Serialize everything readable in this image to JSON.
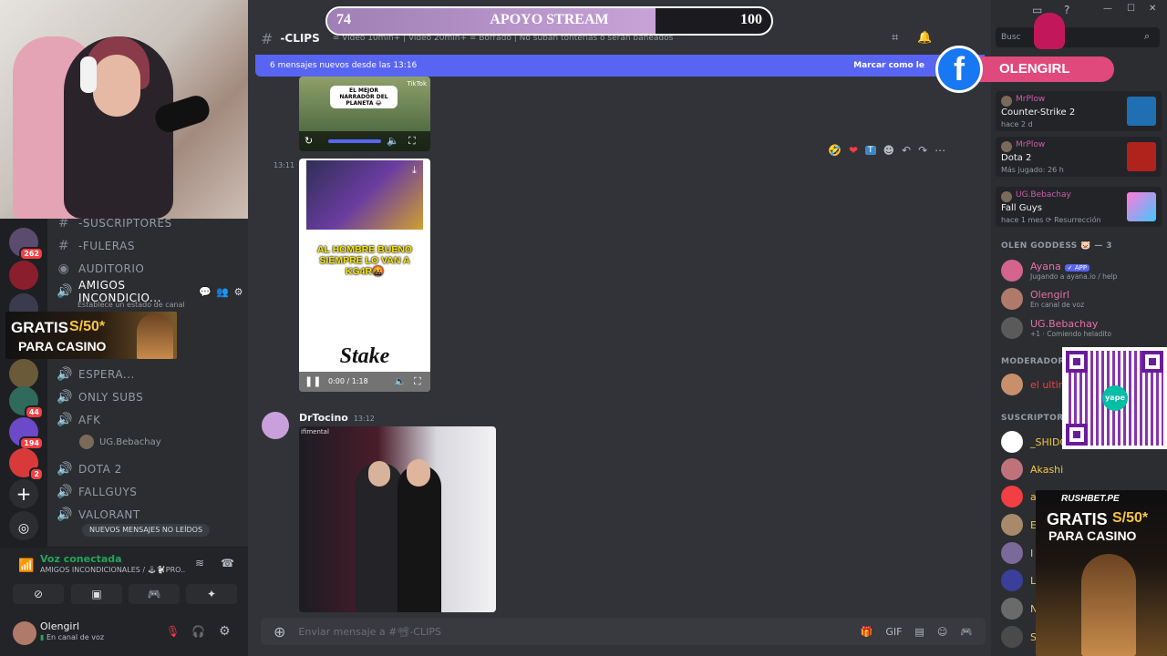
{
  "window": {
    "minimize_icon": "—",
    "maximize_icon": "☐",
    "close_icon": "✕"
  },
  "overlay": {
    "support": {
      "current": "74",
      "label": "APOYO STREAM",
      "goal": "100",
      "progress": 0.74
    },
    "facebook": {
      "glyph": "f",
      "name": "OLENGIRL"
    },
    "qr": {
      "logo": "yape"
    },
    "casino_top": {
      "line1": "GRATIS",
      "amount": "S/50*",
      "line2": "PARA CASINO"
    },
    "casino_bottom": {
      "brand": "RUSHBET.PE",
      "line1": "GRATIS",
      "amount": "S/50*",
      "line2": "PARA CASINO"
    }
  },
  "servers": [
    {
      "badge": "262"
    },
    {
      "badge": ""
    },
    {
      "badge": ""
    },
    {
      "badge": ""
    },
    {
      "badge": "44"
    },
    {
      "badge": "194"
    },
    {
      "badge": "2"
    }
  ],
  "channels": {
    "items": [
      {
        "icon": "#",
        "name": "-SUSCRIPTORES"
      },
      {
        "icon": "#",
        "name": "-FULERAS"
      },
      {
        "icon": "◉",
        "name": "AUDITORIO"
      },
      {
        "icon": "🔊",
        "name": "AMIGOS INCONDICIO...",
        "sub": "Establece un estado de canal"
      },
      {
        "icon": "🔊",
        "name": "ESPERA..."
      },
      {
        "icon": "🔊",
        "name": "ONLY SUBS"
      },
      {
        "icon": "🔊",
        "name": "AFK"
      },
      {
        "icon": "🔊",
        "name": "DOTA 2"
      },
      {
        "icon": "🔊",
        "name": "FALLGUYS"
      },
      {
        "icon": "🔊",
        "name": "VALORANT"
      }
    ],
    "afk_user": "UG.Bebachay",
    "unread_pill": "NUEVOS MENSAJES NO LEÍDOS"
  },
  "voice": {
    "status": "Voz conectada",
    "channel": "AMIGOS INCONDICIONALES / 🕹🐩PRO..."
  },
  "user": {
    "name": "Olengirl",
    "status": "En canal de voz"
  },
  "chat": {
    "channel": "-CLIPS",
    "topic": "= Video 10min+ | Video 20min+ = Borrado | No suban tonterías o serán baneados",
    "new_messages": "6 mensajes nuevos desde las 13:16",
    "mark_read": "Marcar como le",
    "clip1_caption": "EL MEJOR NARRADOR DEL PLANETA 😂",
    "clip1_brand": "TikTok",
    "msg_time_1": "13:11",
    "clip2_text": "AL HOMBRE BUENO SIEMPRE LO VAN A KG4R🤬",
    "clip2_logo": "Stake",
    "clip2_time": "0:00 / 1:18",
    "author": "DrTocino",
    "author_time": "13:12",
    "photo_text": "ifimental",
    "composer_placeholder": "Enviar mensaje a #📽-CLIPS"
  },
  "right": {
    "search_placeholder": "Busc",
    "activities": [
      {
        "who": "MrPlow",
        "game": "Counter-Strike 2",
        "meta": "hace 2 d"
      },
      {
        "who": "MrPlow",
        "game": "Dota 2",
        "meta": "Más jugado: 26 h"
      },
      {
        "who": "UG.Bebachay",
        "game": "Fall Guys",
        "meta": "hace 1 mes  ⟳ Resurrección"
      }
    ],
    "group_goddess": "OLEN GODDESS 🐷 — 3",
    "members": [
      {
        "name": "Ayana",
        "tag": "✓ APP",
        "status": "Jugando a ayana.io / help",
        "color": "#e86fa9"
      },
      {
        "name": "Olengirl",
        "status": "En canal de voz",
        "color": "#e86fa9"
      },
      {
        "name": "UG.Bebachay",
        "status": "+1 · Comiendo heladito",
        "color": "#e86fa9"
      }
    ],
    "group_mod": "MODERADOR",
    "mod_member": "el ultim",
    "group_subs": "SUSCRIPTORE",
    "subs": [
      "_SHIDO",
      "Akashi",
      "a",
      "E",
      "I",
      "L",
      "N",
      "S"
    ]
  }
}
